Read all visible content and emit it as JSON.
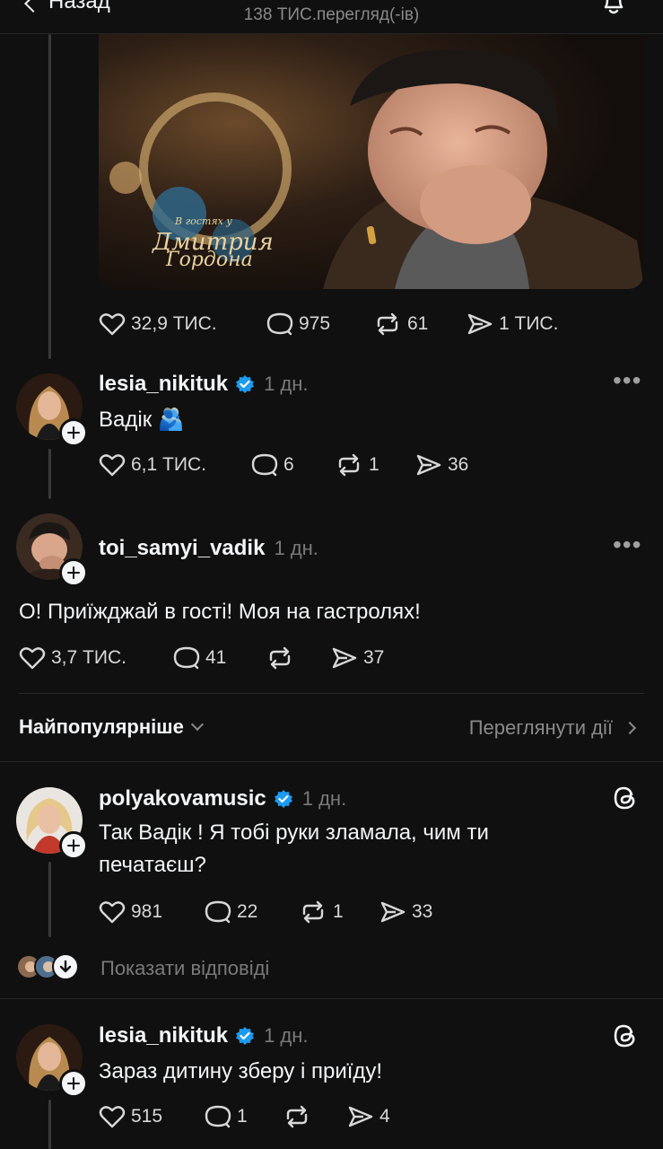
{
  "header": {
    "back_label": "Назад",
    "views": "138 ТИС.перегляд(-ів)"
  },
  "main_post": {
    "media_caption_line1": "В гостях у",
    "media_caption_line2": "Дмитрия",
    "media_caption_line3": "Гордона",
    "likes": "32,9 ТИС.",
    "comments": "975",
    "reposts": "61",
    "shares": "1 ТИС."
  },
  "reply1": {
    "username": "lesia_nikituk",
    "time": "1 дн.",
    "text": "Вадік 🫂",
    "likes": "6,1 ТИС.",
    "comments": "6",
    "reposts": "1",
    "shares": "36"
  },
  "reply2": {
    "username": "toi_samyi_vadik",
    "time": "1 дн.",
    "text": "О! Приїжджай в гості! Моя на гастролях!",
    "likes": "3,7 ТИС.",
    "comments": "41",
    "reposts": "",
    "shares": "37"
  },
  "sort": {
    "label": "Найпопулярніше",
    "view_actions": "Переглянути дії"
  },
  "comment1": {
    "username": "polyakovamusic",
    "time": "1 дн.",
    "text_line1": "Так Вадік ! Я тобі руки зламала, чим ти",
    "text_line2": "печатаєш?",
    "likes": "981",
    "comments": "22",
    "reposts": "1",
    "shares": "33",
    "show_replies": "Показати відповіді"
  },
  "comment2": {
    "username": "lesia_nikituk",
    "time": "1 дн.",
    "text": "Зараз дитину зберу і приїду!",
    "likes": "515",
    "comments": "1",
    "reposts": "",
    "shares": "4"
  },
  "colors": {
    "background": "#101010",
    "text": "#f3f5f7",
    "muted": "#7a7a7a",
    "verified": "#1d9bf0"
  }
}
